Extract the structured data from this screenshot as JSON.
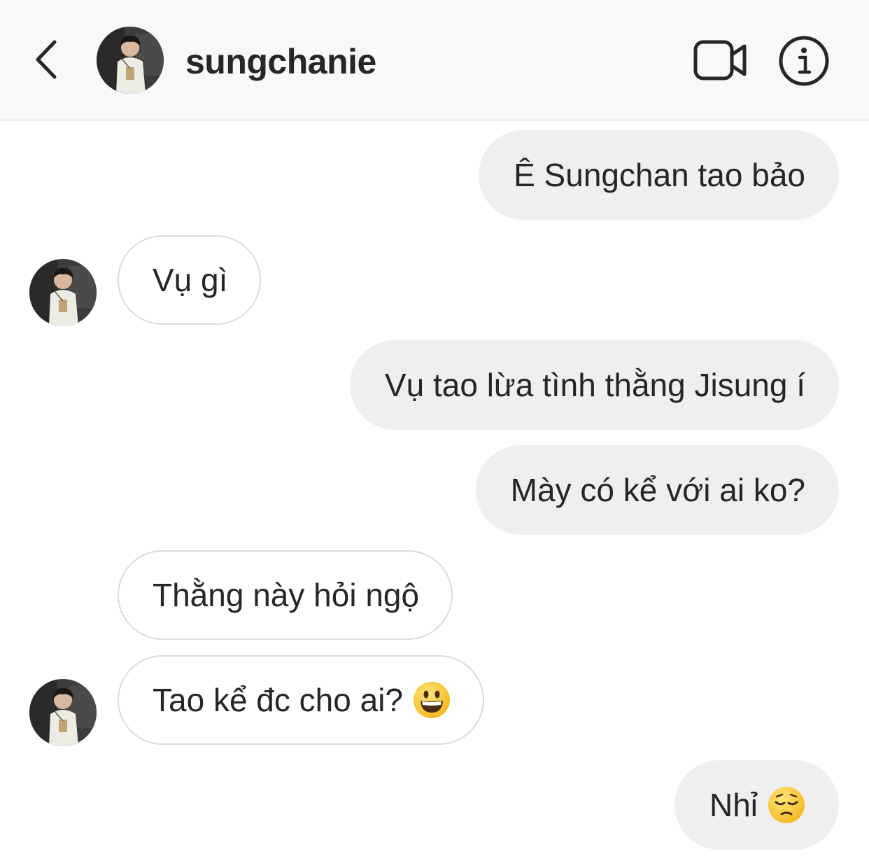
{
  "header": {
    "username": "sungchanie",
    "icons": {
      "back": "chevron-left-icon",
      "video": "video-camera-icon",
      "info": "info-circle-icon"
    }
  },
  "messages": [
    {
      "sender": "me",
      "text": "Ê Sungchan tao bảo"
    },
    {
      "sender": "sungchanie",
      "text": "Vụ gì",
      "show_avatar": true
    },
    {
      "sender": "me",
      "text": "Vụ tao lừa tình thằng Jisung í"
    },
    {
      "sender": "me",
      "text": "Mày có kể với ai ko?"
    },
    {
      "sender": "sungchanie",
      "text": "Thằng này hỏi ngộ",
      "show_avatar": false
    },
    {
      "sender": "sungchanie",
      "text": "Tao kể đc cho ai?",
      "emoji": "grinning-face-emoji",
      "show_avatar": true
    },
    {
      "sender": "me",
      "text": "Nhỉ",
      "emoji": "pensive-face-emoji"
    }
  ],
  "colors": {
    "header_bg": "#f8f8f8",
    "outgoing_bubble": "#efefef",
    "incoming_border": "#dbdbdb",
    "text": "#262626"
  }
}
